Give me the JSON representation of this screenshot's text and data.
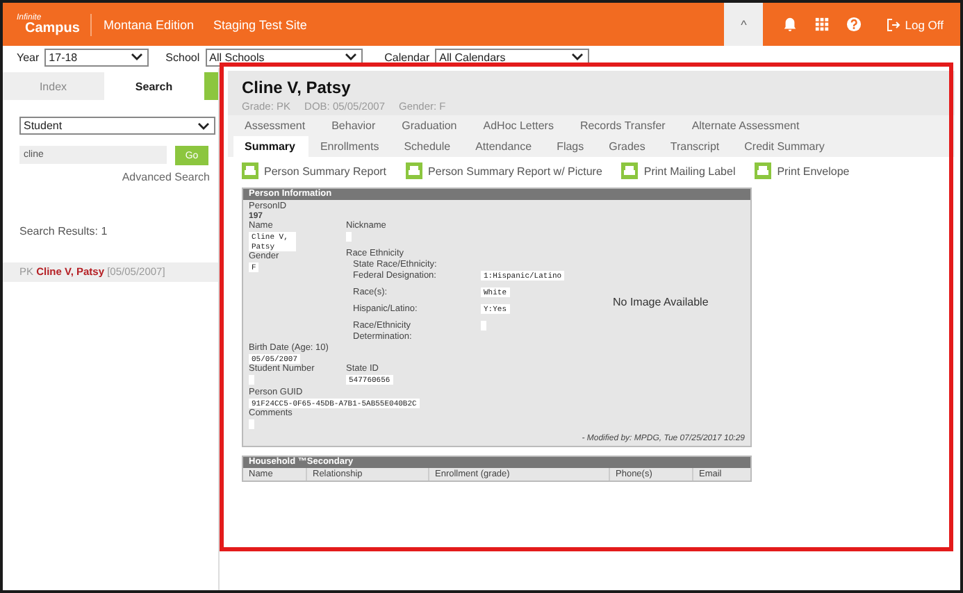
{
  "top_bar": {
    "logo_small": "Infinite",
    "logo_large": "Campus",
    "edition": "Montana Edition",
    "site": "Staging Test Site",
    "collapse": "^",
    "log_off": "Log Off"
  },
  "filters": [
    {
      "label": "Year",
      "value": "17-18"
    },
    {
      "label": "School",
      "value": "All Schools"
    },
    {
      "label": "Calendar",
      "value": "All Calendars"
    }
  ],
  "sidebar": {
    "tabs": [
      {
        "label": "Index",
        "selected": false
      },
      {
        "label": "Search",
        "selected": true
      }
    ],
    "search_type": "Student",
    "query": "cline",
    "go": "Go",
    "advanced": "Advanced Search",
    "results_label": "Search Results: 1",
    "results": [
      {
        "grade": "PK",
        "name": "Cline V, Patsy",
        "dob": "[05/05/2007]"
      }
    ]
  },
  "student": {
    "name": "Cline V, Patsy",
    "grade": "Grade: PK",
    "dob": "DOB: 05/05/2007",
    "gender": "Gender: F"
  },
  "tab_rows": [
    [
      {
        "label": "Assessment",
        "selected": false
      },
      {
        "label": "Behavior",
        "selected": false
      },
      {
        "label": "Graduation",
        "selected": false
      },
      {
        "label": "AdHoc Letters",
        "selected": false
      },
      {
        "label": "Records Transfer",
        "selected": false
      },
      {
        "label": "Alternate Assessment",
        "selected": false
      }
    ],
    [
      {
        "label": "Summary",
        "selected": true
      },
      {
        "label": "Enrollments",
        "selected": false
      },
      {
        "label": "Schedule",
        "selected": false
      },
      {
        "label": "Attendance",
        "selected": false
      },
      {
        "label": "Flags",
        "selected": false
      },
      {
        "label": "Grades",
        "selected": false
      },
      {
        "label": "Transcript",
        "selected": false
      },
      {
        "label": "Credit Summary",
        "selected": false
      }
    ]
  ],
  "reports": [
    "Person Summary Report",
    "Person Summary Report w/ Picture",
    "Print Mailing Label",
    "Print Envelope"
  ],
  "person_info": {
    "title": "Person Information",
    "person_id_label": "PersonID",
    "person_id": "197",
    "name_label": "Name",
    "name": "Cline V, Patsy",
    "nickname_label": "Nickname",
    "gender_label": "Gender",
    "gender": "F",
    "race_label": "Race Ethnicity",
    "state_race_label": "State Race/Ethnicity:",
    "race_rows": [
      {
        "label": "Federal Designation:",
        "value": "1:Hispanic/Latino"
      },
      {
        "label": "Race(s):",
        "value": "White"
      },
      {
        "label": "Hispanic/Latino:",
        "value": "Y:Yes"
      },
      {
        "label": "Race/Ethnicity Determination:"
      }
    ],
    "no_image": "No Image Available",
    "birth_label": "Birth Date (Age: 10)",
    "birth": "05/05/2007",
    "student_number_label": "Student Number",
    "state_id_label": "State ID",
    "state_id": "547760656",
    "guid_label": "Person GUID",
    "guid": "91F24CC5-0F65-45DB-A7B1-5AB55E040B2C",
    "comments_label": "Comments",
    "modified": "- Modified by: MPDG, Tue 07/25/2017 10:29"
  },
  "household": {
    "title": "Household ™Secondary",
    "columns": [
      "Name",
      "Relationship",
      "Enrollment (grade)",
      "Phone(s)",
      "Email"
    ]
  }
}
